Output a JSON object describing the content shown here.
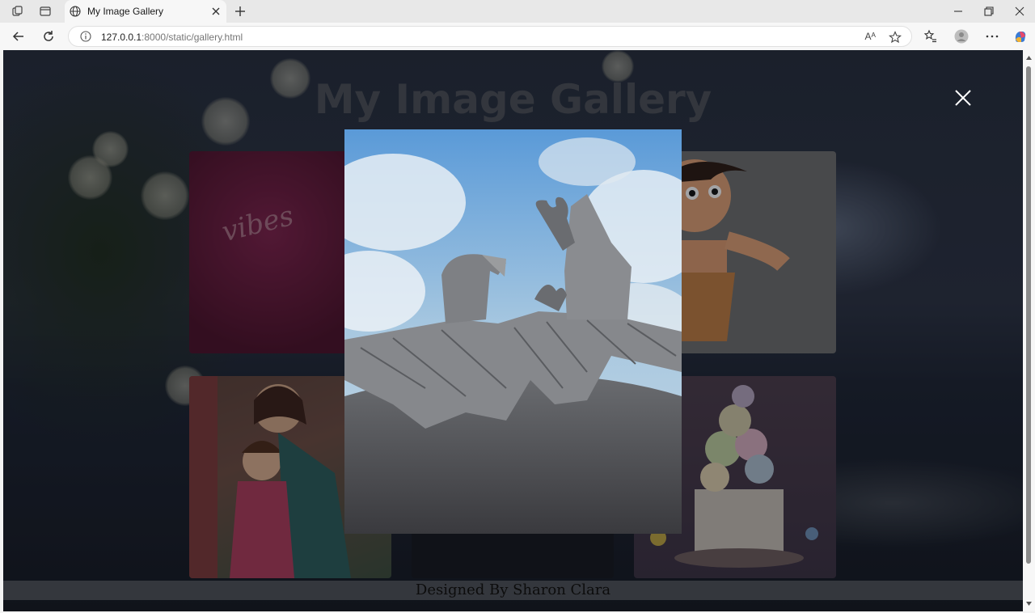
{
  "browser": {
    "tab_title": "My Image Gallery",
    "url_host": "127.0.0.1",
    "url_rest": ":8000/static/gallery.html",
    "read_aloud_label": "Aᴬ"
  },
  "page": {
    "title": "My Image Gallery",
    "footer": "Designed By Sharon Clara",
    "tile1_text": "vibes",
    "lightbox_alt": "Eagle sculpture on rock"
  },
  "colors": {
    "overlay": "#0a0c12",
    "footer_bg": "#34373d",
    "close_icon": "#ffffff"
  }
}
